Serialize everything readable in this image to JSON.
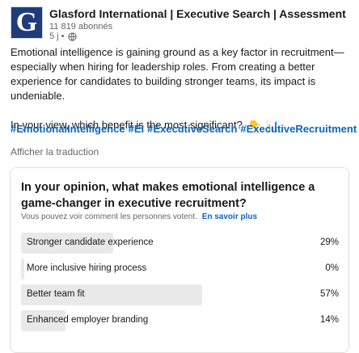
{
  "header": {
    "logo_letter": "G",
    "author_name": "Glasford International | Executive Search | Assessment | ...",
    "followers": "11 819 abonnés",
    "time": "5 j •",
    "visibility_icon": "globe-icon"
  },
  "post": {
    "paragraph1": "Emotional intelligence is gaining ground as a key factor in recruitment—especially when hiring for leadership roles. From creating a better experience for candidates to building stronger teams, its impact is undeniable.",
    "paragraph2": "In your view, which benefit is the most significant?",
    "emoji_1": "👇",
    "emoji_2": "📊",
    "hashtags": [
      "#EmotionalIntelligence",
      "#EI",
      "#ExecutiveSearch",
      "#ExecutiveRecruitment"
    ],
    "translate_label": "Afficher la traduction"
  },
  "poll": {
    "question": "In your opinion, what makes emotional intelligence a game-changer in executive recruitment?",
    "note": "Vous pouvez voir comment les personnes votent.",
    "note_link": "En savoir plus",
    "options": [
      {
        "label": "Stronger candidate experience",
        "percent_label": "29%",
        "percent": 29
      },
      {
        "label": "More inclusive hiring process",
        "percent_label": "0%",
        "percent": 0
      },
      {
        "label": "Better team fit",
        "percent_label": "57%",
        "percent": 57
      },
      {
        "label": "Enhanced employer branding",
        "percent_label": "14%",
        "percent": 14
      }
    ]
  }
}
